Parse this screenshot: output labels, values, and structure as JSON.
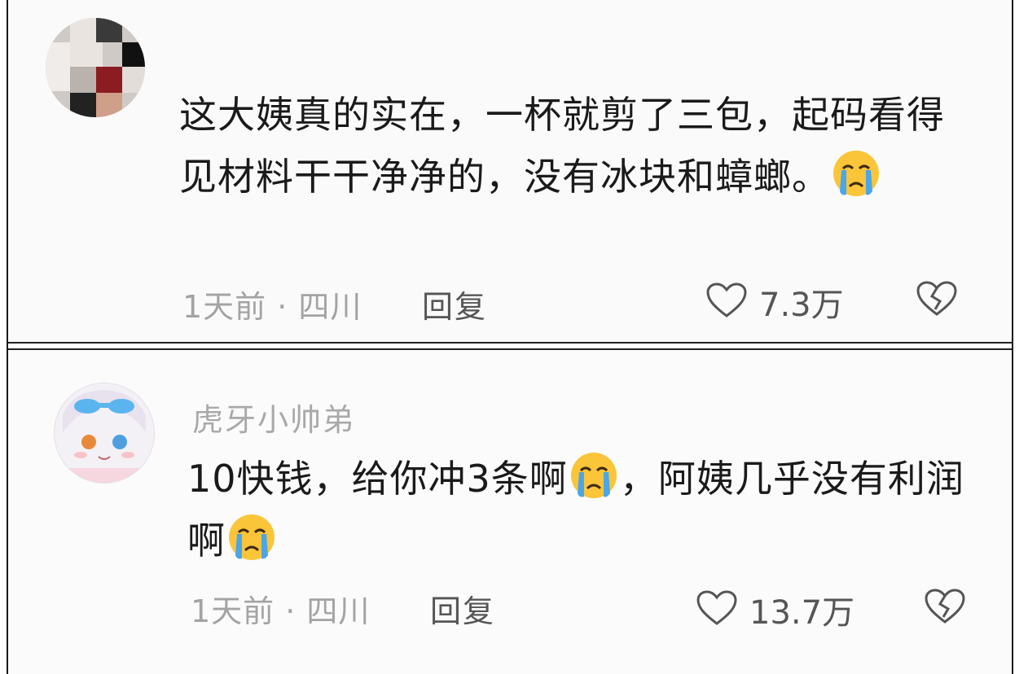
{
  "comments": [
    {
      "username": "",
      "text_parts": [
        "这大姨真的实在，一杯就剪了三包，起码看得见材料干干净净的，没有冰块和蟑螂。"
      ],
      "time_location": "1天前 · 四川",
      "reply_label": "回复",
      "like_count": "7.3万"
    },
    {
      "username": "虎牙小帅弟",
      "text_parts": [
        "10快钱，给你冲3条啊",
        "，阿姨几乎没有利润啊"
      ],
      "time_location": "1天前 · 四川",
      "reply_label": "回复",
      "like_count": "13.7万"
    }
  ],
  "icons": {
    "emoji": "crying-face-icon",
    "like": "heart-outline-icon",
    "dislike": "broken-heart-icon"
  },
  "colors": {
    "text": "#1a1a1a",
    "meta": "#a3a3a3",
    "emoji_face": "#fbc53a",
    "emoji_tears": "#4aa6e8"
  }
}
